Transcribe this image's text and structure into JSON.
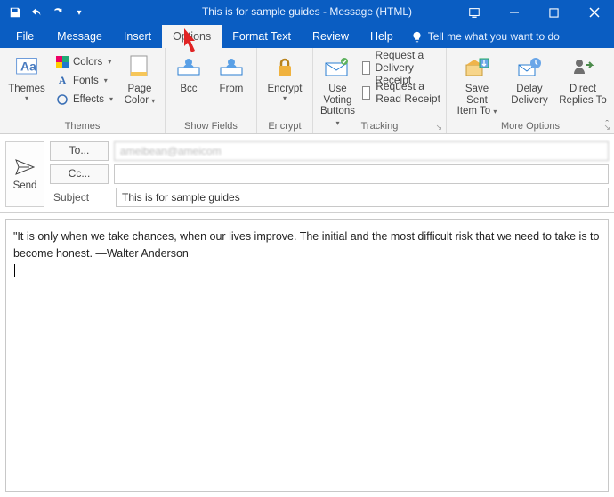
{
  "title": "This is for sample guides  -  Message (HTML)",
  "tabs": {
    "file": "File",
    "message": "Message",
    "insert": "Insert",
    "options": "Options",
    "format_text": "Format Text",
    "review": "Review",
    "help": "Help",
    "tellme": "Tell me what you want to do"
  },
  "ribbon": {
    "themes": {
      "themes_btn": "Themes",
      "colors": "Colors",
      "fonts": "Fonts",
      "effects": "Effects",
      "page_color_l1": "Page",
      "page_color_l2": "Color",
      "group": "Themes"
    },
    "show_fields": {
      "bcc": "Bcc",
      "from": "From",
      "group": "Show Fields"
    },
    "encrypt": {
      "encrypt": "Encrypt",
      "group": "Encrypt"
    },
    "tracking": {
      "voting_l1": "Use Voting",
      "voting_l2": "Buttons",
      "delivery": "Request a Delivery Receipt",
      "read": "Request a Read Receipt",
      "group": "Tracking"
    },
    "more": {
      "save_sent_l1": "Save Sent",
      "save_sent_l2": "Item To",
      "delay_l1": "Delay",
      "delay_l2": "Delivery",
      "direct_l1": "Direct",
      "direct_l2": "Replies To",
      "group": "More Options"
    }
  },
  "compose": {
    "send": "Send",
    "to_btn": "To...",
    "cc_btn": "Cc...",
    "subject_label": "Subject",
    "to_value": "ameibean@ameicom",
    "cc_value": "",
    "subject_value": "This is for sample guides",
    "body": "\"It is only when we take chances, when our lives improve. The initial and the most difficult risk that we need to take is to become honest. —Walter Anderson"
  }
}
